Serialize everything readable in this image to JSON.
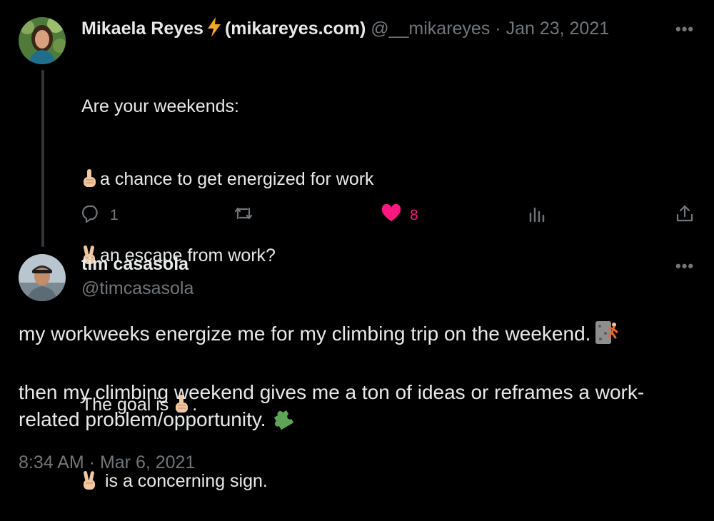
{
  "parent_tweet": {
    "author_name": "Mikaela Reyes",
    "author_name_suffix": "(mikareyes.com)",
    "handle": "@__mikareyes",
    "separator": "·",
    "date": "Jan 23, 2021",
    "more_label": "•••",
    "lines": [
      "Are your weekends:",
      "a chance to get energized for work",
      "an escape from work?",
      "",
      "The goal is",
      ".",
      "is a concerning sign."
    ],
    "hand_icons": [
      "index-pointing-up-icon",
      "victory-hand-icon"
    ],
    "reply_count": "1",
    "like_count": "8",
    "colors": {
      "like": "#f91880",
      "muted": "#71767b",
      "bolt": "#f5a623"
    }
  },
  "reply_tweet": {
    "author_name": "tim casasola",
    "handle": "@timcasasola",
    "more_label": "•••",
    "paragraph_1": "my workweeks energize me for my climbing trip on the weekend.",
    "paragraph_2": "then my climbing weekend gives me a ton of ideas or reframes a work-related problem/opportunity.",
    "timestamp": "8:34 AM · Mar 6, 2021"
  }
}
